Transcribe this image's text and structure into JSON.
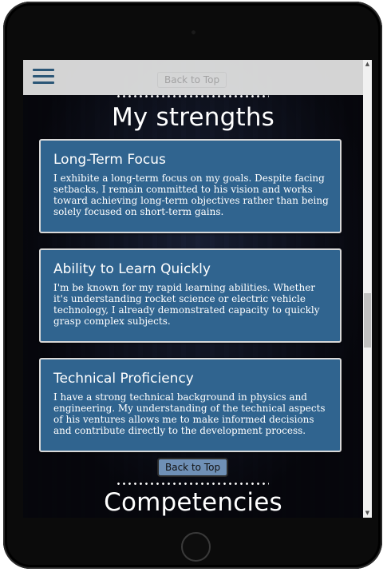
{
  "header": {
    "menu_icon": "hamburger-icon",
    "back_to_top_label": "Back to Top"
  },
  "strengths": {
    "title": "My strengths",
    "cards": [
      {
        "title": "Long-Term Focus",
        "body": "I exhibite a long-term focus on my goals. Despite facing setbacks, I remain committed to his vision and works toward achieving long-term objectives rather than being solely focused on short-term gains."
      },
      {
        "title": "Ability to Learn Quickly",
        "body": "I'm be known for my rapid learning abilities. Whether it's understanding rocket science or electric vehicle technology, I already demonstrated capacity to quickly grasp complex subjects."
      },
      {
        "title": "Technical Proficiency",
        "body": "I have a strong technical background in physics and engineering. My understanding of the technical aspects of his ventures allows me to make informed decisions and contribute directly to the development process."
      }
    ],
    "back_to_top_label": "Back to Top"
  },
  "competencies": {
    "title": "Competencies"
  },
  "colors": {
    "card_background": "#30648f",
    "header_background": "#e4e4e4",
    "menu_icon": "#2c5777",
    "back_button": "#6f90b6"
  }
}
